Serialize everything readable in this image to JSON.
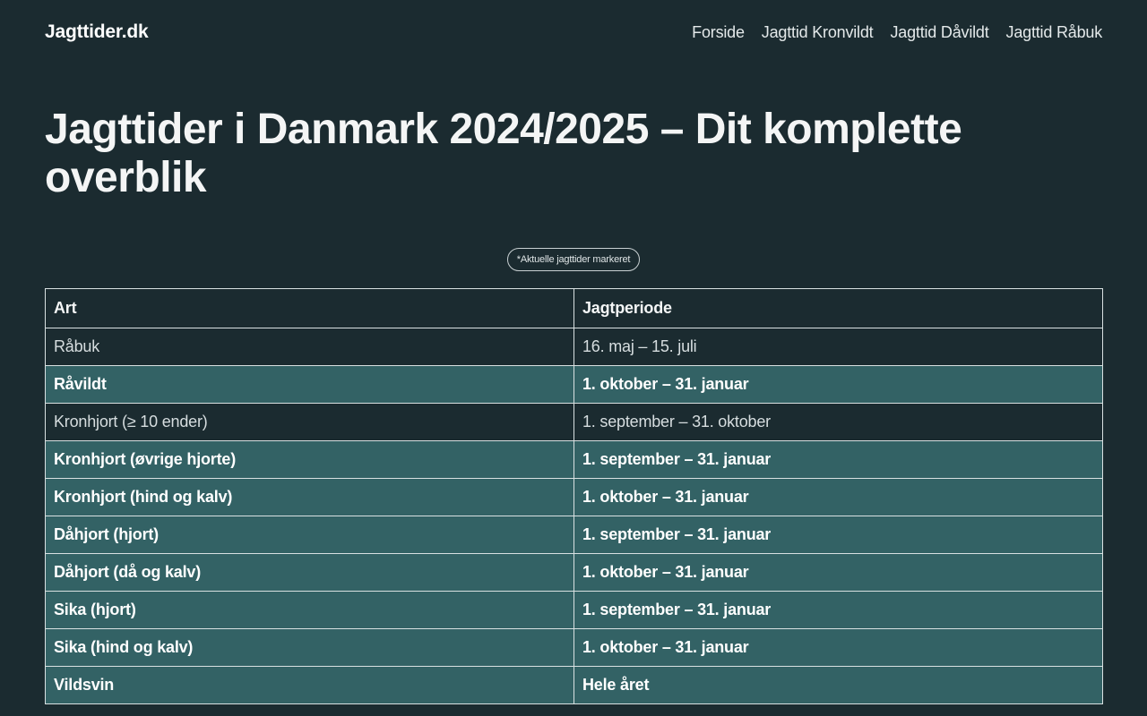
{
  "site": {
    "logo": "Jagttider.dk"
  },
  "nav": {
    "items": [
      {
        "label": "Forside"
      },
      {
        "label": "Jagttid Kronvildt"
      },
      {
        "label": "Jagttid Dåvildt"
      },
      {
        "label": "Jagttid Råbuk"
      }
    ]
  },
  "main": {
    "title": "Jagttider i Danmark 2024/2025 – Dit komplette overblik",
    "note": "*Aktuelle jagttider markeret"
  },
  "table": {
    "headers": [
      "Art",
      "Jagtperiode"
    ],
    "rows": [
      {
        "art": "Råbuk",
        "periode": "16. maj – 15. juli",
        "current": false
      },
      {
        "art": "Råvildt",
        "periode": "1. oktober – 31. januar",
        "current": true
      },
      {
        "art": "Kronhjort (≥ 10 ender)",
        "periode": "1. september – 31. oktober",
        "current": false
      },
      {
        "art": "Kronhjort (øvrige hjorte)",
        "periode": "1. september – 31. januar",
        "current": true
      },
      {
        "art": "Kronhjort (hind og kalv)",
        "periode": "1. oktober – 31. januar",
        "current": true
      },
      {
        "art": "Dåhjort (hjort)",
        "periode": "1. september – 31. januar",
        "current": true
      },
      {
        "art": "Dåhjort (då og kalv)",
        "periode": "1. oktober – 31. januar",
        "current": true
      },
      {
        "art": "Sika (hjort)",
        "periode": "1. september – 31. januar",
        "current": true
      },
      {
        "art": "Sika (hind og kalv)",
        "periode": "1. oktober – 31. januar",
        "current": true
      },
      {
        "art": "Vildsvin",
        "periode": "Hele året",
        "current": true
      }
    ]
  },
  "colors": {
    "background": "#1b2b30",
    "current_row": "#336265",
    "border": "#d9e1e2"
  }
}
